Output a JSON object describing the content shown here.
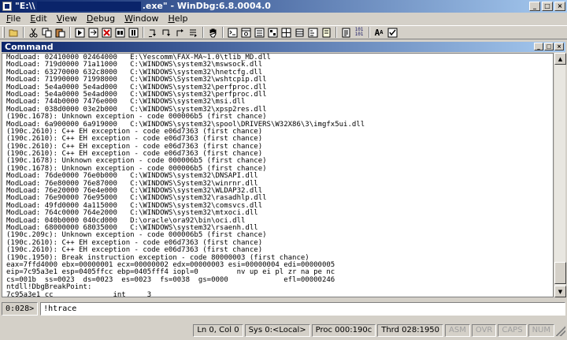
{
  "window": {
    "title_left": "\"E:\\\\",
    "title_right": ".exe\" - WinDbg:6.8.0004.0"
  },
  "menu": [
    {
      "label": "File",
      "hotkey": "F",
      "rest": "ile"
    },
    {
      "label": "Edit",
      "hotkey": "E",
      "rest": "dit"
    },
    {
      "label": "View",
      "hotkey": "V",
      "rest": "iew"
    },
    {
      "label": "Debug",
      "hotkey": "D",
      "rest": "ebug"
    },
    {
      "label": "Window",
      "hotkey": "W",
      "rest": "indow"
    },
    {
      "label": "Help",
      "hotkey": "H",
      "rest": "elp"
    }
  ],
  "toolbar": {
    "buttons": [
      "open-icon",
      "cut-icon",
      "copy-icon",
      "paste-icon",
      "go-icon",
      "restart-icon",
      "stop-debugging-icon",
      "detach-icon",
      "break-icon",
      "step-into-icon",
      "step-over-icon",
      "step-out-icon",
      "run-to-cursor-icon",
      "hand-icon",
      "command-window-icon",
      "watch-window-icon",
      "locals-icon",
      "registers-icon",
      "memory-icon",
      "call-stack-icon",
      "disassembly-icon",
      "scratch-pad-icon",
      "source-mode-icon",
      "hex-mode-icon",
      "font-icon",
      "options-icon"
    ],
    "hex_mode_label": "101\n101",
    "font_label": "A",
    "font_small_label": "A"
  },
  "command_window": {
    "title": "Command",
    "lines": [
      "ModLoad: 02410000 02464000   E:\\Yescomm\\FAX-MA~1.0\\tlib_MD.dll",
      "ModLoad: 719d0000 71a11000   C:\\WINDOWS\\system32\\mswsock.dll",
      "ModLoad: 63270000 632c8000   C:\\WINDOWS\\system32\\hnetcfg.dll",
      "ModLoad: 71990000 71998000   C:\\WINDOWS\\System32\\wshtcpip.dll",
      "ModLoad: 5e4a0000 5e4ad000   C:\\WINDOWS\\system32\\perfproc.dll",
      "ModLoad: 5e4a0000 5e4ad000   C:\\WINDOWS\\system32\\perfproc.dll",
      "ModLoad: 744b0000 7476e000   C:\\WINDOWS\\system32\\msi.dll",
      "ModLoad: 038d0000 03e2b000   C:\\WINDOWS\\system32\\xpsp2res.dll",
      "(190c.1678): Unknown exception - code 000006b5 (first chance)",
      "ModLoad: 6a900000 6a919000   C:\\WINDOWS\\system32\\spool\\DRIVERS\\W32X86\\3\\imgfx5ui.dll",
      "(190c.2610): C++ EH exception - code e06d7363 (first chance)",
      "(190c.2610): C++ EH exception - code e06d7363 (first chance)",
      "(190c.2610): C++ EH exception - code e06d7363 (first chance)",
      "(190c.2610): C++ EH exception - code e06d7363 (first chance)",
      "(190c.1678): Unknown exception - code 000006b5 (first chance)",
      "(190c.1678): Unknown exception - code 000006b5 (first chance)",
      "ModLoad: 76de0000 76e0b000   C:\\WINDOWS\\system32\\DNSAPI.dll",
      "ModLoad: 76e80000 76e87000   C:\\WINDOWS\\System32\\winrnr.dll",
      "ModLoad: 76e20000 76e4e000   C:\\WINDOWS\\system32\\WLDAP32.dll",
      "ModLoad: 76e90000 76e95000   C:\\WINDOWS\\system32\\rasadhlp.dll",
      "ModLoad: 49fd0000 4a115000   C:\\WINDOWS\\system32\\comsvcs.dll",
      "ModLoad: 764c0000 764e2000   C:\\WINDOWS\\system32\\mtxoci.dll",
      "ModLoad: 040b0000 040cd000   D:\\oracle\\ora92\\bin\\oci.dll",
      "ModLoad: 68000000 68035000   C:\\WINDOWS\\system32\\rsaenh.dll",
      "(190c.209c): Unknown exception - code 000006b5 (first chance)",
      "(190c.2610): C++ EH exception - code e06d7363 (first chance)",
      "(190c.2610): C++ EH exception - code e06d7363 (first chance)",
      "(190c.1950): Break instruction exception - code 80000003 (first chance)",
      "eax=7ffd4000 ebx=00000001 ecx=00000002 edx=00000003 esi=00000004 edi=00000005",
      "eip=7c95a3e1 esp=0405ffcc ebp=0405fff4 iopl=0         nv up ei pl zr na pe nc",
      "cs=001b  ss=0023  ds=0023  es=0023  fs=0038  gs=0000             efl=00000246",
      "ntdll!DbgBreakPoint:",
      "7c95a3e1 cc              int     3"
    ],
    "prompt": "0:028>",
    "input_value": "!htrace"
  },
  "status": {
    "line_col": "Ln 0, Col 0",
    "sys": "Sys 0:<Local>",
    "proc": "Proc 000:190c",
    "thrd": "Thrd 028:1950",
    "asm": "ASM",
    "ovr": "OVR",
    "caps": "CAPS",
    "num": "NUM"
  }
}
